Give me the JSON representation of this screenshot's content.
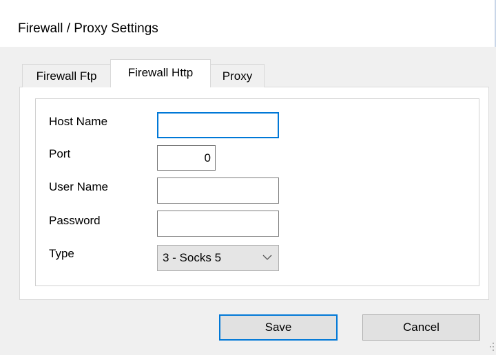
{
  "window": {
    "title": "Firewall / Proxy Settings"
  },
  "tabs": [
    {
      "label": "Firewall Ftp",
      "active": false
    },
    {
      "label": "Firewall Http",
      "active": true
    },
    {
      "label": "Proxy",
      "active": false
    }
  ],
  "form": {
    "host_name": {
      "label": "Host Name",
      "value": ""
    },
    "port": {
      "label": "Port",
      "value": "0"
    },
    "user_name": {
      "label": "User Name",
      "value": ""
    },
    "password": {
      "label": "Password",
      "value": ""
    },
    "type": {
      "label": "Type",
      "selected": "3 - Socks 5"
    }
  },
  "buttons": {
    "save": "Save",
    "cancel": "Cancel"
  },
  "colors": {
    "focus_accent": "#0078d7",
    "window_bg": "#f0f0f0",
    "panel_bg": "#ffffff"
  },
  "icons": {
    "select_arrow": "chevron-down-icon",
    "resize_grip": "resize-grip-icon"
  }
}
